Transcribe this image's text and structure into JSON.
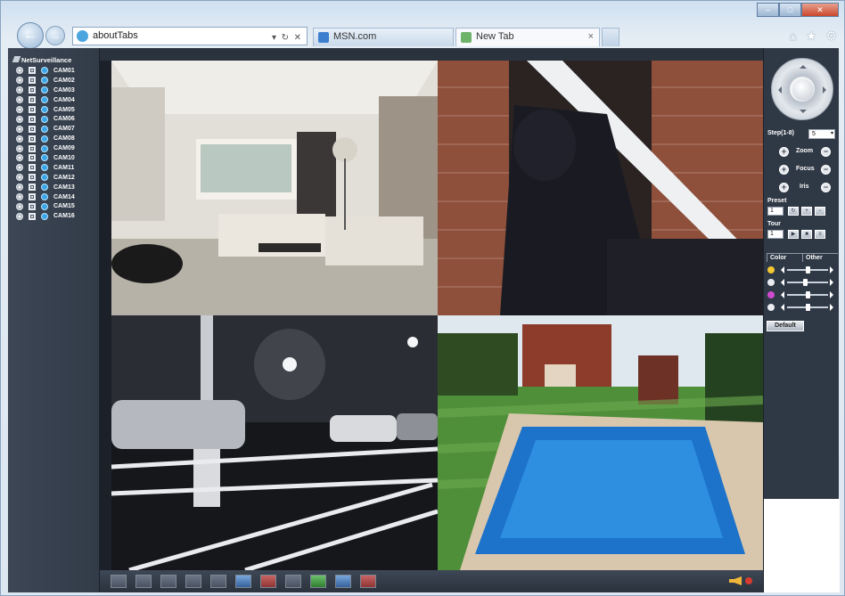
{
  "browser": {
    "address": "aboutTabs",
    "tabs": [
      {
        "label": "MSN.com"
      },
      {
        "label": "New Tab",
        "close": "×"
      }
    ],
    "window_controls": {
      "min": "–",
      "max": "□",
      "close": "✕"
    },
    "icons": {
      "home": "⌂",
      "favorites": "★",
      "tools": "⚙"
    }
  },
  "tree": {
    "title": "NetSurveillance",
    "cameras": [
      "CAM01",
      "CAM02",
      "CAM03",
      "CAM04",
      "CAM05",
      "CAM06",
      "CAM07",
      "CAM08",
      "CAM09",
      "CAM10",
      "CAM11",
      "CAM12",
      "CAM13",
      "CAM14",
      "CAM15",
      "CAM16"
    ]
  },
  "ptz": {
    "step_label": "Step(1-8)",
    "step_value": "5",
    "zoom_label": "Zoom",
    "focus_label": "Focus",
    "iris_label": "Iris",
    "preset_label": "Preset",
    "preset_value": "1",
    "tour_label": "Tour",
    "tour_value": "1",
    "tabs": [
      "Color",
      "Other"
    ],
    "sliders": [
      {
        "name": "brightness",
        "value": 0.5,
        "color": "#f3c832"
      },
      {
        "name": "contrast",
        "value": 0.45,
        "color": "#e9edf2"
      },
      {
        "name": "saturation",
        "value": 0.5,
        "color": "#d04ad0"
      },
      {
        "name": "hue",
        "value": 0.5,
        "color": "#e9edf2"
      }
    ],
    "default_label": "Default"
  }
}
